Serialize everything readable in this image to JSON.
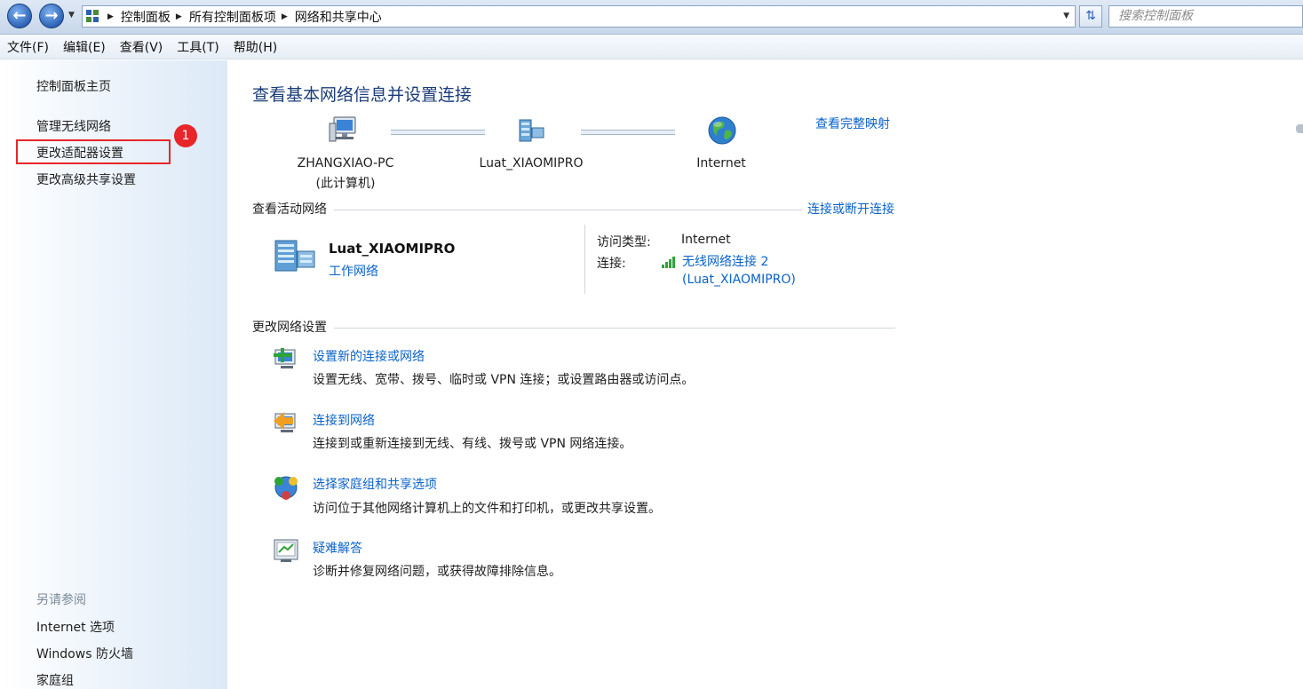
{
  "address_bar": {
    "breadcrumbs": [
      "控制面板",
      "所有控制面板项",
      "网络和共享中心"
    ],
    "search_placeholder": "搜索控制面板"
  },
  "menu": [
    "文件(F)",
    "编辑(E)",
    "查看(V)",
    "工具(T)",
    "帮助(H)"
  ],
  "sidebar": {
    "home": "控制面板主页",
    "links": [
      "管理无线网络",
      "更改适配器设置",
      "更改高级共享设置"
    ],
    "see_also_title": "另请参阅",
    "see_also": [
      "Internet 选项",
      "Windows 防火墙",
      "家庭组"
    ]
  },
  "annotation": {
    "badge": "1",
    "color": "#e8262a"
  },
  "main": {
    "title": "查看基本网络信息并设置连接",
    "full_map_link": "查看完整映射",
    "map": {
      "computer_name": "ZHANGXIAO-PC",
      "computer_sub": "(此计算机)",
      "network_name": "Luat_XIAOMIPRO",
      "internet": "Internet"
    },
    "active_section": "查看活动网络",
    "connect_link": "连接或断开连接",
    "active_network": {
      "name": "Luat_XIAOMIPRO",
      "type": "工作网络",
      "access_label": "访问类型:",
      "access_value": "Internet",
      "connection_label": "连接:",
      "connection_value_line1": "无线网络连接 2",
      "connection_value_line2": "(Luat_XIAOMIPRO)"
    },
    "change_section": "更改网络设置",
    "tasks": [
      {
        "title": "设置新的连接或网络",
        "desc": "设置无线、宽带、拨号、临时或 VPN 连接；或设置路由器或访问点。"
      },
      {
        "title": "连接到网络",
        "desc": "连接到或重新连接到无线、有线、拨号或 VPN 网络连接。"
      },
      {
        "title": "选择家庭组和共享选项",
        "desc": "访问位于其他网络计算机上的文件和打印机，或更改共享设置。"
      },
      {
        "title": "疑难解答",
        "desc": "诊断并修复网络问题，或获得故障排除信息。"
      }
    ]
  },
  "colors": {
    "link": "#0a63c9",
    "title": "#1a3d7a"
  }
}
